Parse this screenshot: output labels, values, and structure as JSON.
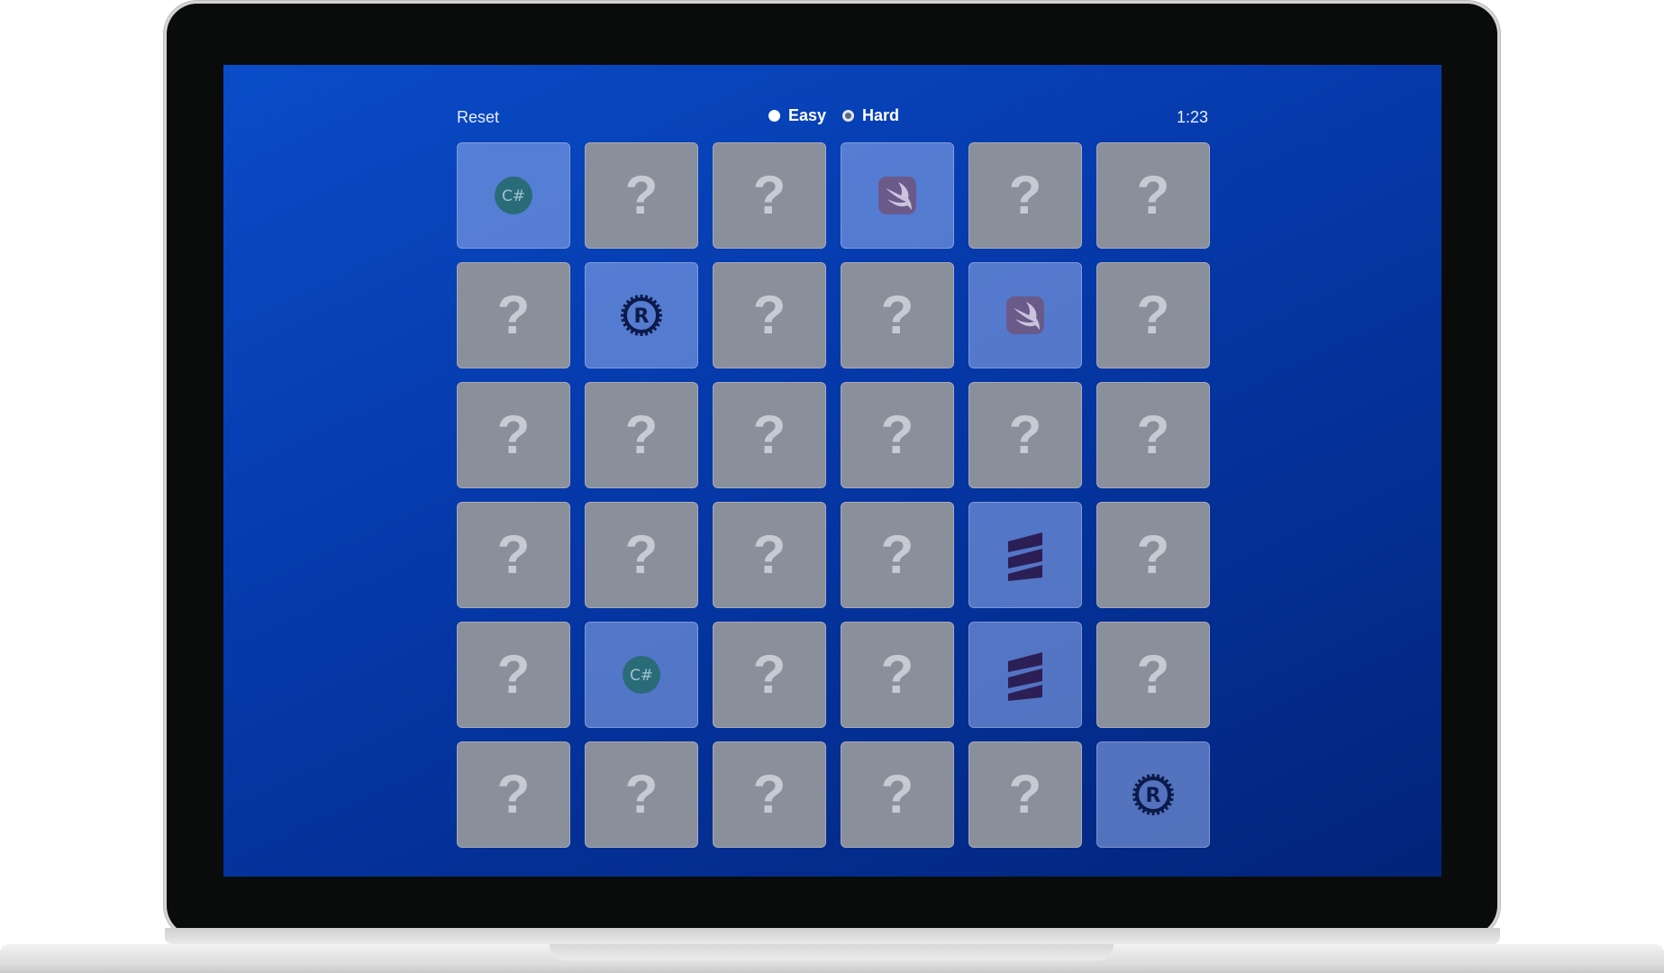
{
  "toolbar": {
    "reset_label": "Reset",
    "modes": [
      {
        "label": "Easy",
        "selected": false
      },
      {
        "label": "Hard",
        "selected": true
      }
    ],
    "timer": "1:23"
  },
  "board": {
    "hidden_symbol": "?",
    "rows": [
      [
        {
          "state": "revealed",
          "icon": "csharp-icon"
        },
        {
          "state": "hidden"
        },
        {
          "state": "hidden"
        },
        {
          "state": "revealed",
          "icon": "swift-icon"
        },
        {
          "state": "hidden"
        },
        {
          "state": "hidden"
        }
      ],
      [
        {
          "state": "hidden"
        },
        {
          "state": "revealed",
          "icon": "rust-icon"
        },
        {
          "state": "hidden"
        },
        {
          "state": "hidden"
        },
        {
          "state": "revealed",
          "icon": "swift-icon"
        },
        {
          "state": "hidden"
        }
      ],
      [
        {
          "state": "hidden"
        },
        {
          "state": "hidden"
        },
        {
          "state": "hidden"
        },
        {
          "state": "hidden"
        },
        {
          "state": "hidden"
        },
        {
          "state": "hidden"
        }
      ],
      [
        {
          "state": "hidden"
        },
        {
          "state": "hidden"
        },
        {
          "state": "hidden"
        },
        {
          "state": "hidden"
        },
        {
          "state": "revealed",
          "icon": "scala-icon"
        },
        {
          "state": "hidden"
        }
      ],
      [
        {
          "state": "hidden"
        },
        {
          "state": "revealed",
          "icon": "csharp-icon"
        },
        {
          "state": "hidden"
        },
        {
          "state": "hidden"
        },
        {
          "state": "revealed",
          "icon": "scala-icon"
        },
        {
          "state": "hidden"
        }
      ],
      [
        {
          "state": "hidden"
        },
        {
          "state": "hidden"
        },
        {
          "state": "hidden"
        },
        {
          "state": "hidden"
        },
        {
          "state": "hidden"
        },
        {
          "state": "revealed",
          "icon": "rust-icon"
        }
      ]
    ],
    "icon_text": {
      "csharp-icon": "C#",
      "rust-icon": "R"
    }
  },
  "colors": {
    "csharp": "#2a6b78",
    "swift": "#6a5a8a",
    "rust": "#0c1a4a",
    "scala": "#2c1f55"
  }
}
